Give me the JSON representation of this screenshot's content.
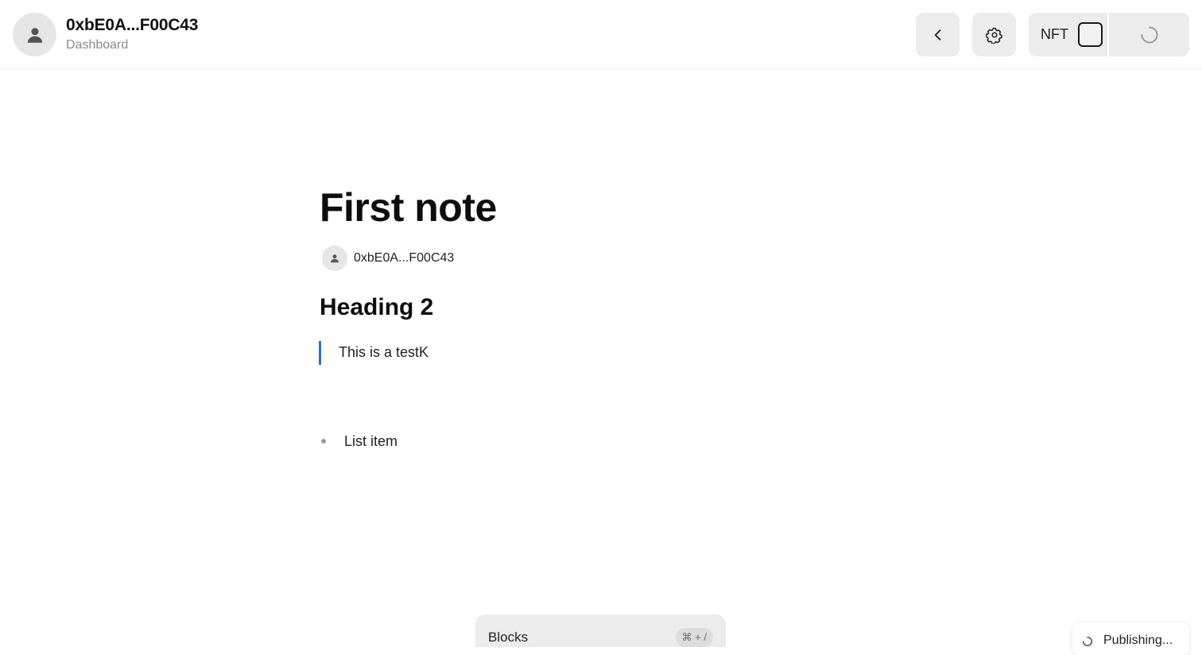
{
  "header": {
    "account_name": "0xbE0A...F00C43",
    "account_subtitle": "Dashboard",
    "avatar_icon": "user-icon",
    "back_icon": "chevron-left-icon",
    "settings_icon": "gear-icon",
    "nft_label": "NFT",
    "nft_checked": false,
    "publish_icon": "spinner-icon"
  },
  "note": {
    "title": "First note",
    "author": "0xbE0A...F00C43",
    "heading": "Heading 2",
    "quote": "This is a testK",
    "list_items": [
      "List item"
    ]
  },
  "blocks_bar": {
    "label": "Blocks",
    "shortcut": "⌘ + /"
  },
  "toast": {
    "text": "Publishing..."
  },
  "colors": {
    "quote_accent": "#2a6fd6",
    "button_bg": "#ececec"
  }
}
